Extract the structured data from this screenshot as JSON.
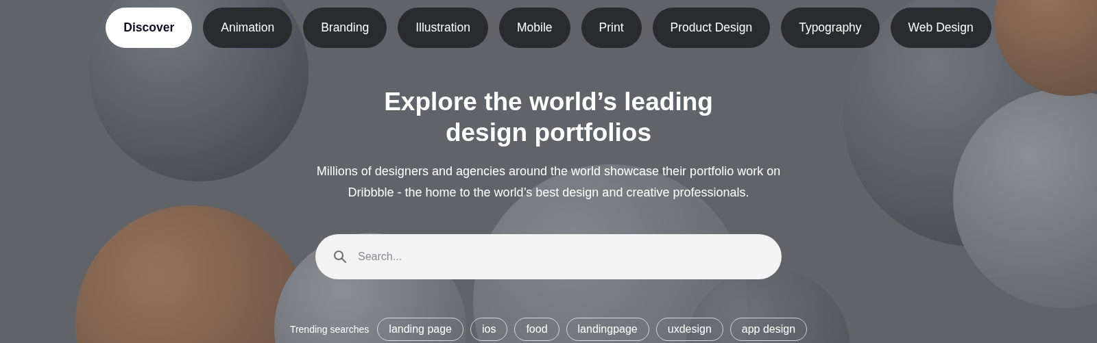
{
  "categories": [
    {
      "label": "Discover",
      "selected": true
    },
    {
      "label": "Animation",
      "selected": false
    },
    {
      "label": "Branding",
      "selected": false
    },
    {
      "label": "Illustration",
      "selected": false
    },
    {
      "label": "Mobile",
      "selected": false
    },
    {
      "label": "Print",
      "selected": false
    },
    {
      "label": "Product Design",
      "selected": false
    },
    {
      "label": "Typography",
      "selected": false
    },
    {
      "label": "Web Design",
      "selected": false
    }
  ],
  "hero": {
    "title": "Explore the world’s leading design portfolios",
    "subtitle": "Millions of designers and agencies around the world showcase their portfolio work on Dribbble - the home to the world’s best design and creative professionals."
  },
  "search": {
    "placeholder": "Search..."
  },
  "trending": {
    "label": "Trending searches",
    "tags": [
      "landing page",
      "ios",
      "food",
      "landingpage",
      "uxdesign",
      "app design"
    ]
  }
}
